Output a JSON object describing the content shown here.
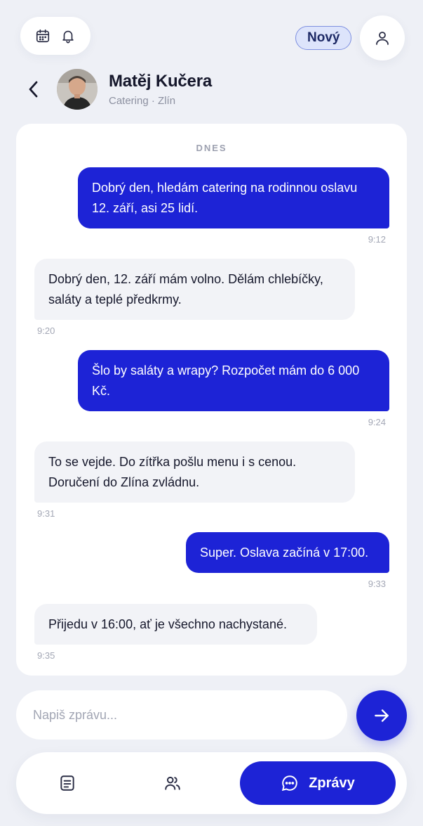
{
  "header": {
    "badge_label": "Nový",
    "icons": [
      "calendar-icon",
      "bell-icon",
      "user-icon",
      "back-arrow-icon"
    ]
  },
  "contact": {
    "name": "Matěj Kučera",
    "subtitle": "Catering · Zlín"
  },
  "chat": {
    "day_label": "DNES",
    "messages": [
      {
        "direction": "out",
        "text": "Dobrý den, hledám catering na rodinnou oslavu 12. září, asi 25 lidí.",
        "time": "9:12"
      },
      {
        "direction": "in",
        "text": "Dobrý den, 12. září mám volno. Dělám chlebíčky, saláty a teplé předkrmy.",
        "time": "9:20"
      },
      {
        "direction": "out",
        "text": "Šlo by saláty a wrapy? Rozpočet mám do 6 000 Kč.",
        "time": "9:24"
      },
      {
        "direction": "in",
        "text": "To se vejde. Do zítřka pošlu menu i s cenou. Doručení do Zlína zvládnu.",
        "time": "9:31"
      },
      {
        "direction": "out",
        "text": "Super. Oslava začíná v 17:00.",
        "time": "9:33"
      },
      {
        "direction": "in",
        "text": "Přijedu v 16:00, ať je všechno nachystané.",
        "time": "9:35"
      }
    ]
  },
  "composer": {
    "placeholder": "Napiš zprávu...",
    "value": ""
  },
  "nav": {
    "active_label": "Zprávy",
    "items": [
      "list-icon",
      "users-icon",
      "chat-icon"
    ]
  },
  "colors": {
    "accent": "#1d23d6",
    "background": "#eef0f6",
    "incoming_bubble": "#f2f3f7",
    "badge_bg": "#dde4fb"
  }
}
